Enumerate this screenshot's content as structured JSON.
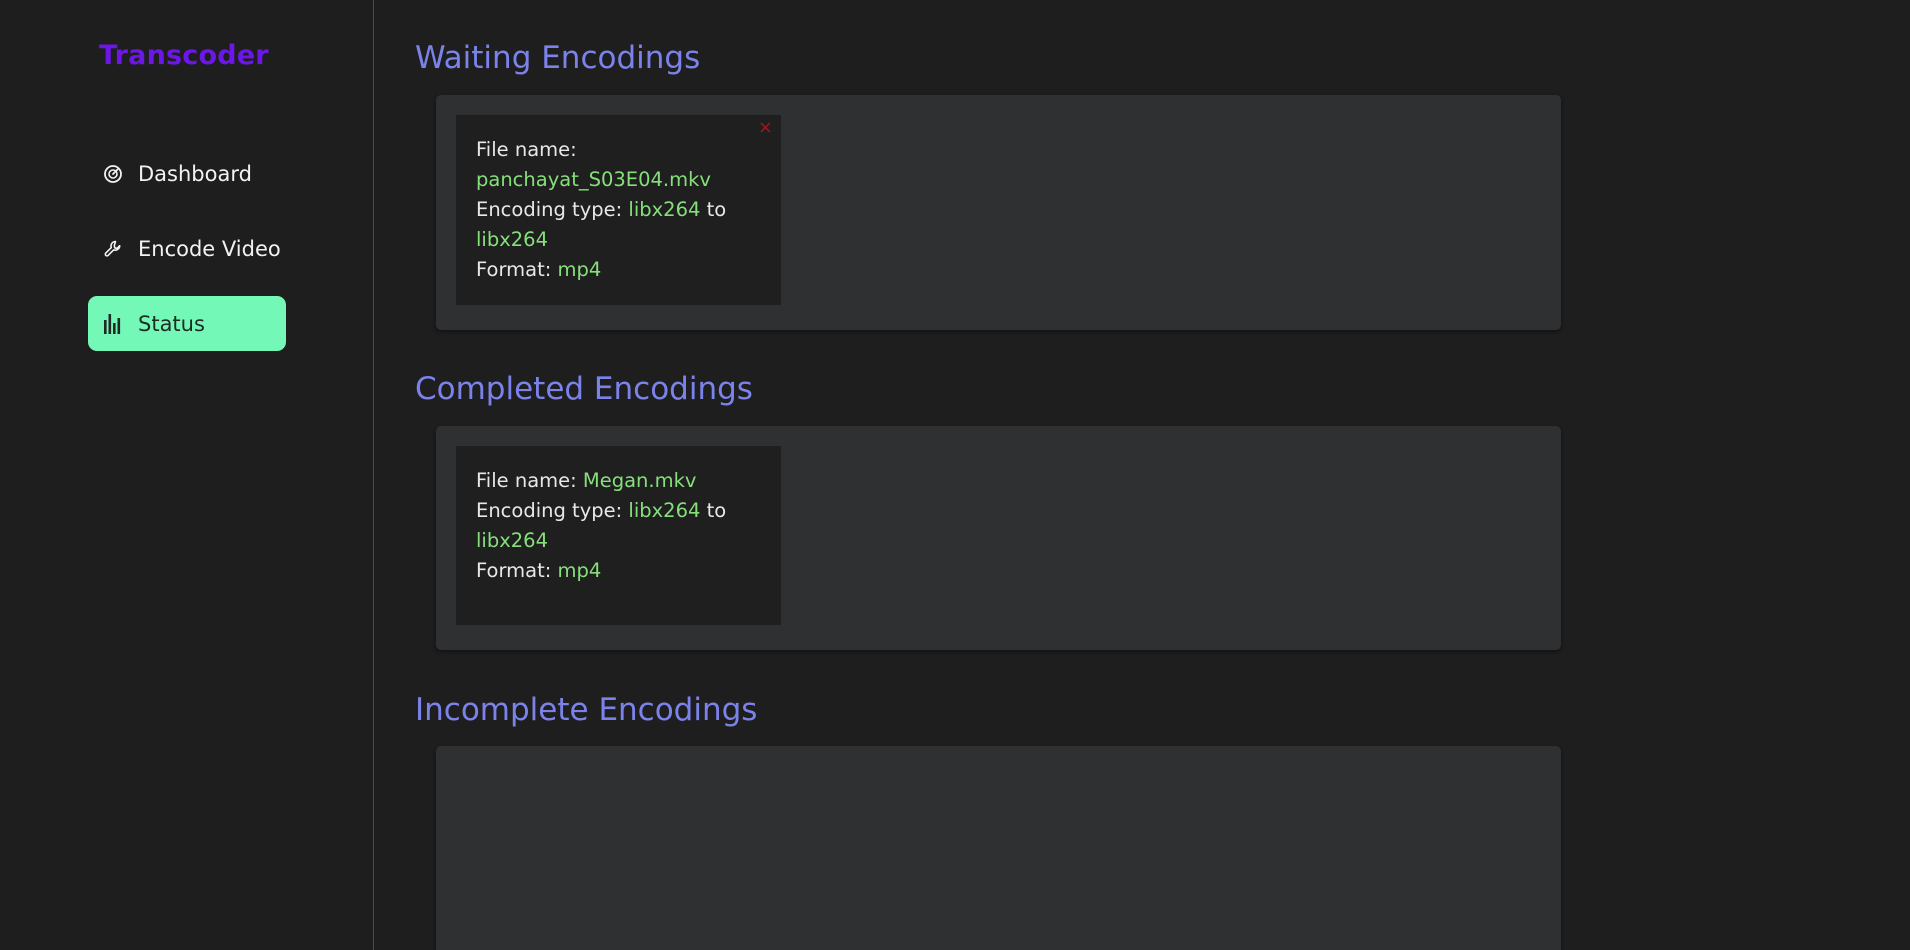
{
  "sidebar": {
    "brand": "Transcoder",
    "items": [
      {
        "label": "Dashboard",
        "icon": "gauge-icon",
        "active": false
      },
      {
        "label": "Encode Video",
        "icon": "wrench-icon",
        "active": false
      },
      {
        "label": "Status",
        "icon": "bar-chart-icon",
        "active": true
      }
    ]
  },
  "colors": {
    "brand": "#6d16e8",
    "active_nav": "#74f8b7",
    "section_title": "#7b83ea",
    "value_text": "#86e07a",
    "close": "#a3161b"
  },
  "sections": {
    "waiting": {
      "title": "Waiting Encodings",
      "items": [
        {
          "file_label": "File name:",
          "file_name": "panchayat_S03E04.mkv",
          "encoding_label": "Encoding type:",
          "encoding_from": "libx264",
          "to_label": "to",
          "encoding_to": "libx264",
          "format_label": "Format:",
          "format": "mp4",
          "close_glyph": "×"
        }
      ]
    },
    "completed": {
      "title": "Completed Encodings",
      "items": [
        {
          "file_label": "File name:",
          "file_name": "Megan.mkv",
          "encoding_label": "Encoding type:",
          "encoding_from": "libx264",
          "to_label": "to",
          "encoding_to": "libx264",
          "format_label": "Format:",
          "format": "mp4"
        }
      ]
    },
    "incomplete": {
      "title": "Incomplete Encodings",
      "items": []
    }
  }
}
